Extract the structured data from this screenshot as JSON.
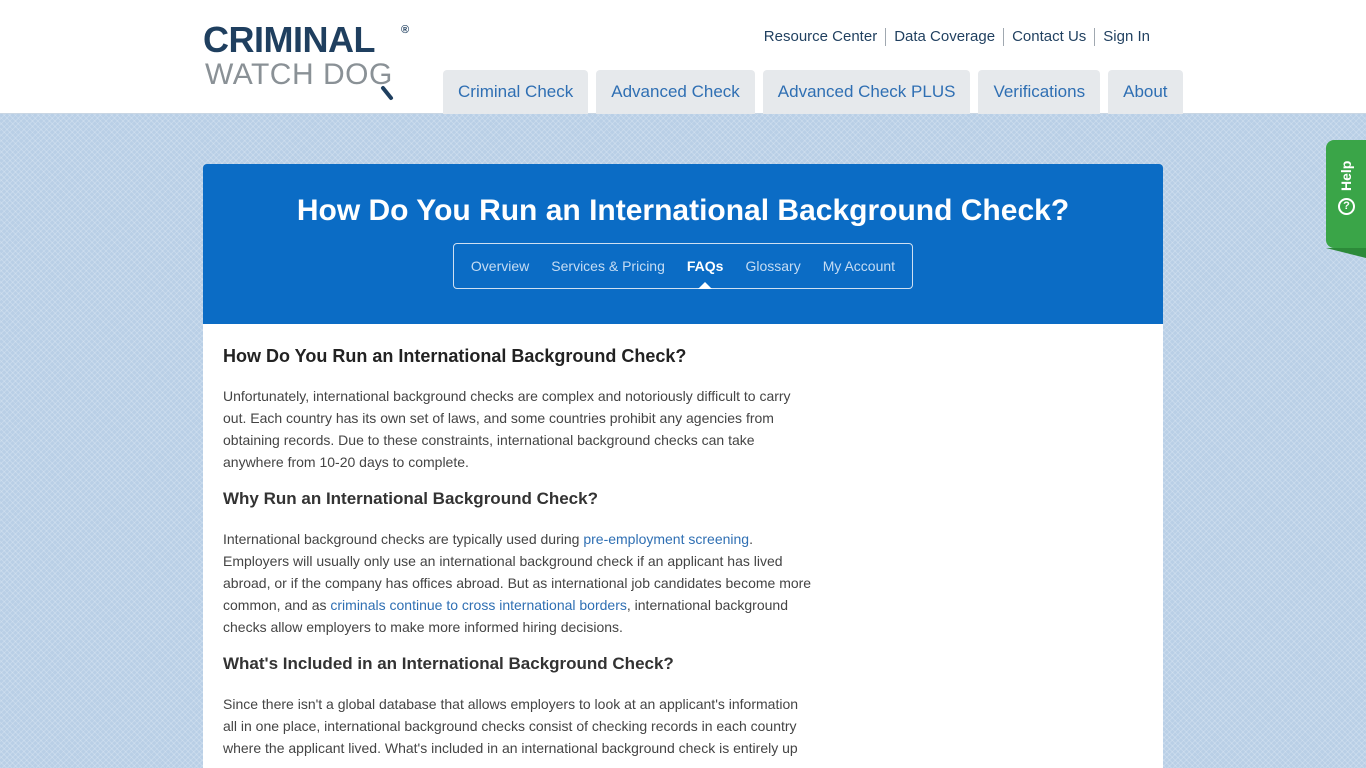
{
  "logo": {
    "line1": "CRIMINAL",
    "reg": "®",
    "line2": "WATCH DOG"
  },
  "util_nav": [
    "Resource Center",
    "Data Coverage",
    "Contact Us",
    "Sign In"
  ],
  "main_nav": [
    "Criminal Check",
    "Advanced Check",
    "Advanced Check PLUS",
    "Verifications",
    "About"
  ],
  "help": {
    "label": "Help",
    "icon": "?"
  },
  "banner": {
    "title": "How Do You Run an International Background Check?",
    "sub_nav": [
      "Overview",
      "Services & Pricing",
      "FAQs",
      "Glossary",
      "My Account"
    ],
    "active_tab": "FAQs"
  },
  "article": {
    "h1": "How Do You Run an International Background Check?",
    "p1": "Unfortunately, international background checks are complex and notoriously difficult to carry out. Each country has its own set of laws, and some countries prohibit any agencies from obtaining records. Due to these constraints, international background checks can take anywhere from 10-20 days to complete.",
    "h2a": "Why Run an International Background Check?",
    "p2_a": "International background checks are typically used during ",
    "p2_link1": "pre-employment screening",
    "p2_b": ". Employers will usually only use an international background check if an applicant has lived abroad, or if the company has offices abroad. But as international job candidates become more common, and as ",
    "p2_link2": "criminals continue to cross international borders",
    "p2_c": ", international background checks allow employers to make more informed hiring decisions.",
    "h2b": "What's Included in an International Background Check?",
    "p3": "Since there isn't a global database that allows employers to look at an applicant's information all in one place, international background checks consist of checking records in each country where the applicant lived. What's included in an international background check is entirely up"
  },
  "colors": {
    "banner_blue": "#0b6cc5",
    "link_blue": "#2f6fb3",
    "help_green": "#3aa548",
    "logo_navy": "#1f3f5f"
  }
}
